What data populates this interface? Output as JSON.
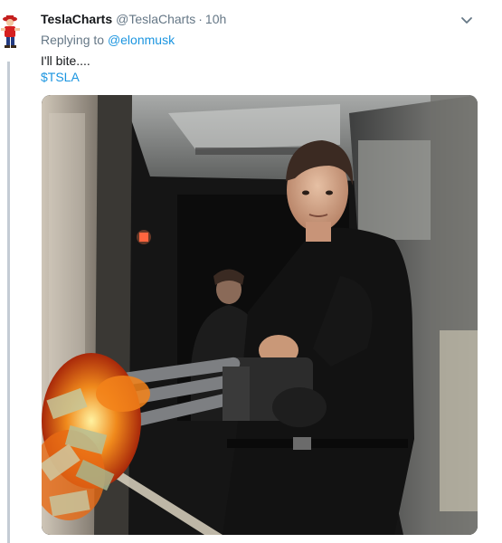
{
  "author": {
    "name": "TeslaCharts",
    "handle": "@TeslaCharts",
    "separator": "·",
    "time": "10h"
  },
  "reply": {
    "prefix": "Replying to",
    "mention": "@elonmusk"
  },
  "text": {
    "line1": "I'll bite....",
    "cashtag": "$TSLA"
  },
  "colors": {
    "link": "#1b95e0",
    "secondary": "#657786",
    "primary_text": "#14171a",
    "thread_line": "#c4ccd4"
  },
  "icons": {
    "menu": "chevron-down-icon",
    "avatar": "cartoon-avatar"
  }
}
